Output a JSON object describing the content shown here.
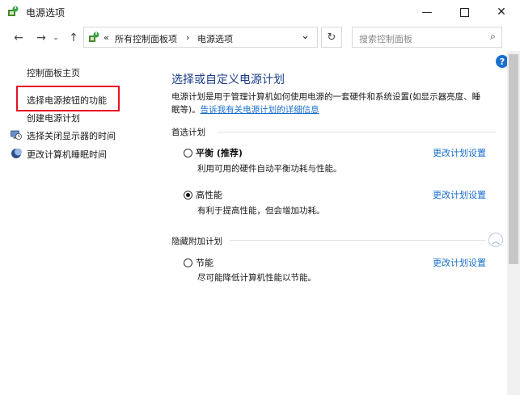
{
  "window": {
    "title": "电源选项",
    "icons": {
      "app": "power-options-icon",
      "minimize": "minimize-icon",
      "maximize": "maximize-icon",
      "close": "close-icon"
    }
  },
  "nav": {
    "back_icon": "arrow-left-icon",
    "forward_icon": "arrow-right-icon",
    "history_icon": "chevron-down-icon",
    "up_icon": "arrow-up-icon"
  },
  "address": {
    "prefix": "«",
    "crumb1": "所有控制面板项",
    "sep": "›",
    "crumb2": "电源选项",
    "dropdown_glyph": "⌄",
    "refresh_glyph": "↻"
  },
  "search": {
    "placeholder": "搜索控制面板",
    "glyph": "⌕"
  },
  "help_glyph": "?",
  "sidebar": {
    "home": "控制面板主页",
    "items": [
      {
        "label": "选择电源按钮的功能",
        "highlighted": true
      },
      {
        "label": "创建电源计划"
      },
      {
        "label": "选择关闭显示器的时间",
        "icon": "monitor-clock-icon"
      },
      {
        "label": "更改计算机睡眠时间",
        "icon": "moon-sleep-icon"
      }
    ]
  },
  "main": {
    "title": "选择或自定义电源计划",
    "desc_line1": "电源计划是用于管理计算机如何使用电源的一套硬件和系统设置(如显示器亮度、睡",
    "desc_line2_prefix": "眠等)。",
    "desc_link": "告诉我有关电源计划的详细信息",
    "preferred_header": "首选计划",
    "hidden_header": "隐藏附加计划",
    "collapse_glyph": "︿",
    "plans": [
      {
        "name": "平衡 (推荐)",
        "description": "利用可用的硬件自动平衡功耗与性能。",
        "link": "更改计划设置",
        "selected": false
      },
      {
        "name": "高性能",
        "description": "有利于提高性能，但会增加功耗。",
        "link": "更改计划设置",
        "selected": true
      },
      {
        "name": "节能",
        "description": "尽可能降低计算机性能以节能。",
        "link": "更改计划设置",
        "selected": false
      }
    ]
  },
  "colors": {
    "accent_link": "#1a6fcf",
    "heading": "#1a3c8a",
    "highlight_box": "#e81123"
  }
}
